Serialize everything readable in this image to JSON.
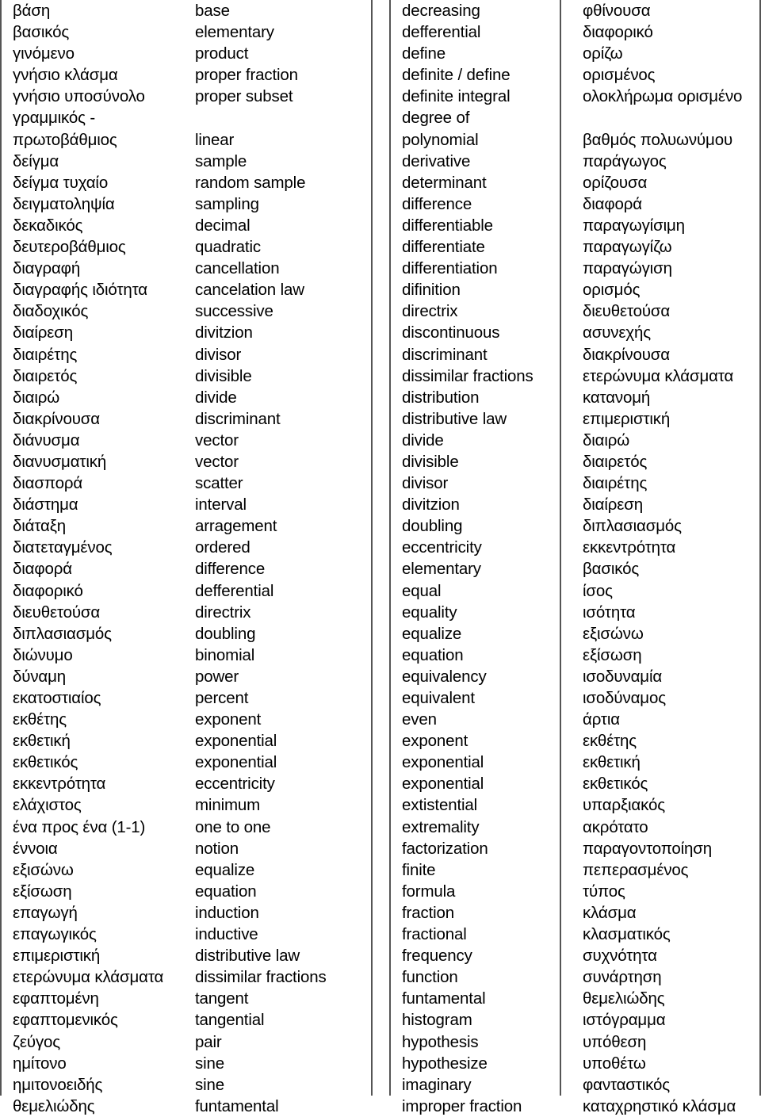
{
  "document": {
    "type": "bilingual-glossary",
    "title_not_shown": "",
    "panels": [
      {
        "id": "greek-to-english",
        "source_language": "Greek",
        "target_language": "English",
        "rows": [
          {
            "term": "βάση",
            "definition": "base"
          },
          {
            "term": "βασικός",
            "definition": "elementary"
          },
          {
            "term": "γινόμενο",
            "definition": "product"
          },
          {
            "term": "γνήσιο κλάσμα",
            "definition": "proper  fraction"
          },
          {
            "term": "γνήσιο υποσύνολο",
            "definition": "proper subset"
          },
          {
            "term": "γραμμικός -",
            "definition": ""
          },
          {
            "term": "πρωτοβάθμιος",
            "definition": "linear"
          },
          {
            "term": "δείγμα",
            "definition": "sample"
          },
          {
            "term": "δείγμα τυχαίο",
            "definition": "random sample"
          },
          {
            "term": "δειγματοληψία",
            "definition": "sampling"
          },
          {
            "term": "δεκαδικός",
            "definition": "decimal"
          },
          {
            "term": "δευτεροβάθμιος",
            "definition": "quadratic"
          },
          {
            "term": "διαγραφή",
            "definition": "cancellation"
          },
          {
            "term": "διαγραφής ιδιότητα",
            "definition": "cancelation law"
          },
          {
            "term": "διαδοχικός",
            "definition": "successive"
          },
          {
            "term": "διαίρεση",
            "definition": "divitzion"
          },
          {
            "term": "διαιρέτης",
            "definition": "divisor"
          },
          {
            "term": "διαιρετός",
            "definition": "divisible"
          },
          {
            "term": "διαιρώ",
            "definition": "divide"
          },
          {
            "term": "διακρίνουσα",
            "definition": "discriminant"
          },
          {
            "term": "διάνυσμα",
            "definition": "vector"
          },
          {
            "term": "διανυσματική",
            "definition": "vector"
          },
          {
            "term": "διασπορά",
            "definition": "scatter"
          },
          {
            "term": "διάστημα",
            "definition": "interval"
          },
          {
            "term": "διάταξη",
            "definition": "arragement"
          },
          {
            "term": "διατεταγμένος",
            "definition": "ordered"
          },
          {
            "term": "διαφορά",
            "definition": "difference"
          },
          {
            "term": "διαφορικό",
            "definition": "defferential"
          },
          {
            "term": "διευθετούσα",
            "definition": "directrix"
          },
          {
            "term": "διπλασιασμός",
            "definition": "doubling"
          },
          {
            "term": "διώνυμο",
            "definition": "binomial"
          },
          {
            "term": "δύναμη",
            "definition": "power"
          },
          {
            "term": "εκατοστιαίος",
            "definition": "percent"
          },
          {
            "term": "εκθέτης",
            "definition": "exponent"
          },
          {
            "term": "εκθετική",
            "definition": "exponential"
          },
          {
            "term": "εκθετικός",
            "definition": "exponential"
          },
          {
            "term": "εκκεντρότητα",
            "definition": "eccentricity"
          },
          {
            "term": "ελάχιστος",
            "definition": "minimum"
          },
          {
            "term": "ένα προς ένα (1-1)",
            "definition": "one to one"
          },
          {
            "term": "έννοια",
            "definition": "notion"
          },
          {
            "term": "εξισώνω",
            "definition": "equalize"
          },
          {
            "term": "εξίσωση",
            "definition": "equation"
          },
          {
            "term": "επαγωγή",
            "definition": "induction"
          },
          {
            "term": "επαγωγικός",
            "definition": "inductive"
          },
          {
            "term": "επιμεριστική",
            "definition": "distributive law"
          },
          {
            "term": "ετερώνυμα κλάσματα",
            "definition": "dissimilar  fractions"
          },
          {
            "term": "εφαπτομένη",
            "definition": "tangent"
          },
          {
            "term": "εφαπτομενικός",
            "definition": "tangential"
          },
          {
            "term": "ζεύγος",
            "definition": "pair"
          },
          {
            "term": "ημίτονο",
            "definition": "sine"
          },
          {
            "term": "ημιτονοειδής",
            "definition": "sine"
          },
          {
            "term": "θεμελιώδης",
            "definition": "funtamental"
          }
        ]
      },
      {
        "id": "english-to-greek",
        "source_language": "English",
        "target_language": "Greek",
        "rows": [
          {
            "term": "decreasing",
            "definition": "φθίνουσα"
          },
          {
            "term": "defferential",
            "definition": "διαφορικό"
          },
          {
            "term": "define",
            "definition": "ορίζω"
          },
          {
            "term": "definite / define",
            "definition": "ορισμένος"
          },
          {
            "term": "definite integral",
            "definition": "ολοκλήρωμα ορισμένο"
          },
          {
            "term": "degree of",
            "definition": ""
          },
          {
            "term": "polynomial",
            "definition": "βαθμός πολυωνύμου"
          },
          {
            "term": "derivative",
            "definition": "παράγωγος"
          },
          {
            "term": "determinant",
            "definition": "ορίζουσα"
          },
          {
            "term": "difference",
            "definition": "διαφορά"
          },
          {
            "term": "differentiable",
            "definition": "παραγωγίσιμη"
          },
          {
            "term": "differentiate",
            "definition": "παραγωγίζω"
          },
          {
            "term": "differentiation",
            "definition": "παραγώγιση"
          },
          {
            "term": "difinition",
            "definition": "ορισμός"
          },
          {
            "term": "directrix",
            "definition": "διευθετούσα"
          },
          {
            "term": "discontinuous",
            "definition": "ασυνεχής"
          },
          {
            "term": "discriminant",
            "definition": "διακρίνουσα"
          },
          {
            "term": "dissimilar fractions",
            "definition": "ετερώνυμα κλάσματα"
          },
          {
            "term": "distribution",
            "definition": "κατανομή"
          },
          {
            "term": "distributive law",
            "definition": "επιμεριστική"
          },
          {
            "term": "divide",
            "definition": "διαιρώ"
          },
          {
            "term": "divisible",
            "definition": "διαιρετός"
          },
          {
            "term": "divisor",
            "definition": "διαιρέτης"
          },
          {
            "term": "divitzion",
            "definition": "διαίρεση"
          },
          {
            "term": "doubling",
            "definition": "διπλασιασμός"
          },
          {
            "term": "eccentricity",
            "definition": "εκκεντρότητα"
          },
          {
            "term": "elementary",
            "definition": "βασικός"
          },
          {
            "term": "equal",
            "definition": "ίσος"
          },
          {
            "term": "equality",
            "definition": "ισότητα"
          },
          {
            "term": "equalize",
            "definition": "εξισώνω"
          },
          {
            "term": "equation",
            "definition": "εξίσωση"
          },
          {
            "term": "equivalency",
            "definition": "ισοδυναμία"
          },
          {
            "term": "equivalent",
            "definition": "ισοδύναμος"
          },
          {
            "term": "even",
            "definition": "άρτια"
          },
          {
            "term": "exponent",
            "definition": "εκθέτης"
          },
          {
            "term": "exponential",
            "definition": "εκθετική"
          },
          {
            "term": "exponential",
            "definition": "εκθετικός"
          },
          {
            "term": "extistential",
            "definition": "υπαρξιακός"
          },
          {
            "term": "extremality",
            "definition": "ακρότατο"
          },
          {
            "term": "factorization",
            "definition": "παραγοντοποίηση"
          },
          {
            "term": "finite",
            "definition": "πεπερασμένος"
          },
          {
            "term": "formula",
            "definition": "τύπος"
          },
          {
            "term": "fraction",
            "definition": "κλάσμα"
          },
          {
            "term": "fractional",
            "definition": "κλασματικός"
          },
          {
            "term": "frequency",
            "definition": "συχνότητα"
          },
          {
            "term": "function",
            "definition": "συνάρτηση"
          },
          {
            "term": "funtamental",
            "definition": "θεμελιώδης"
          },
          {
            "term": "histogram",
            "definition": "ιστόγραμμα"
          },
          {
            "term": "hypothesis",
            "definition": "υπόθεση"
          },
          {
            "term": "hypothesize",
            "definition": "υποθέτω"
          },
          {
            "term": "imaginary",
            "definition": "φανταστικός"
          },
          {
            "term": "improper fraction",
            "definition": "καταχρηστικό κλάσμα"
          }
        ]
      }
    ]
  }
}
